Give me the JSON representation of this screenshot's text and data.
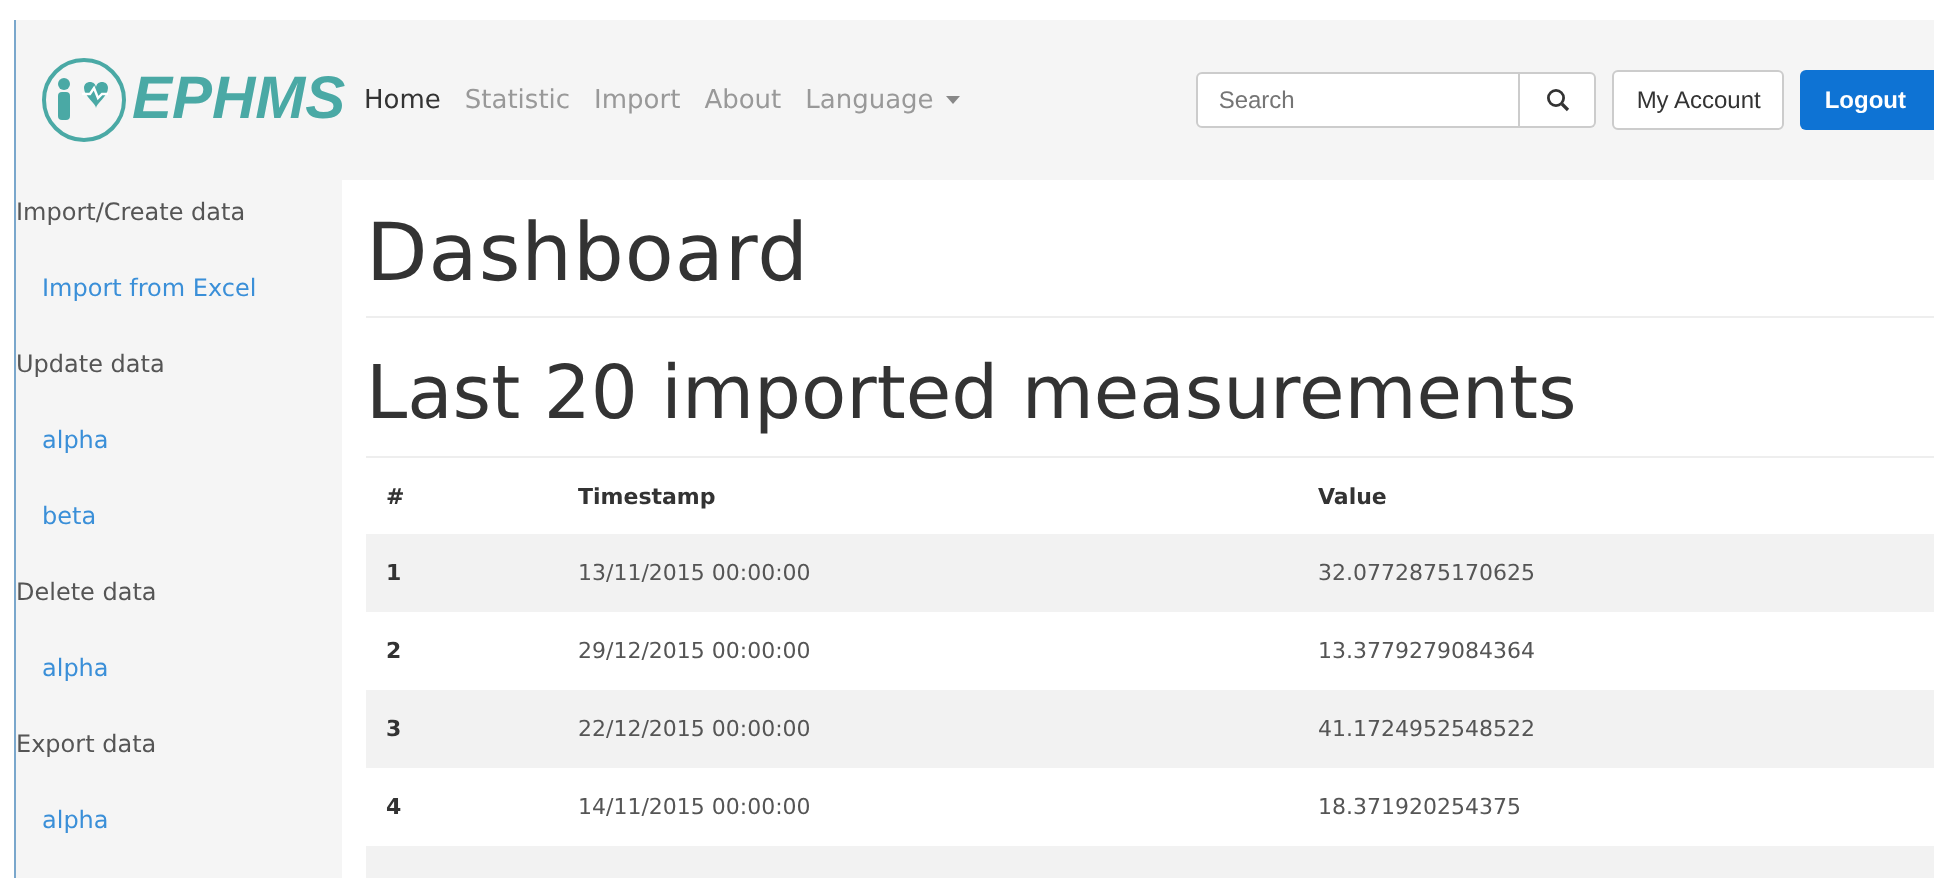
{
  "brand": {
    "name": "EPHMS"
  },
  "nav": [
    {
      "label": "Home",
      "selected": true,
      "kind": "link"
    },
    {
      "label": "Statistic",
      "selected": false,
      "kind": "link"
    },
    {
      "label": "Import",
      "selected": false,
      "kind": "link"
    },
    {
      "label": "About",
      "selected": false,
      "kind": "link"
    },
    {
      "label": "Language",
      "selected": false,
      "kind": "dropdown"
    }
  ],
  "search": {
    "placeholder": "Search"
  },
  "account_button": "My Account",
  "logout_button": "Logout",
  "sidebar": [
    {
      "heading": "Import/Create data",
      "items": [
        "Import from Excel"
      ]
    },
    {
      "heading": "Update data",
      "items": [
        "alpha",
        "beta"
      ]
    },
    {
      "heading": "Delete data",
      "items": [
        "alpha"
      ]
    },
    {
      "heading": "Export data",
      "items": [
        "alpha"
      ]
    }
  ],
  "page_title": "Dashboard",
  "section_title": "Last 20 imported measurements",
  "table": {
    "columns": [
      "#",
      "Timestamp",
      "Value"
    ],
    "rows": [
      [
        "1",
        "13/11/2015 00:00:00",
        "32.0772875170625"
      ],
      [
        "2",
        "29/12/2015 00:00:00",
        "13.3779279084364"
      ],
      [
        "3",
        "22/12/2015 00:00:00",
        "41.1724952548522"
      ],
      [
        "4",
        "14/11/2015 00:00:00",
        "18.371920254375"
      ]
    ]
  }
}
